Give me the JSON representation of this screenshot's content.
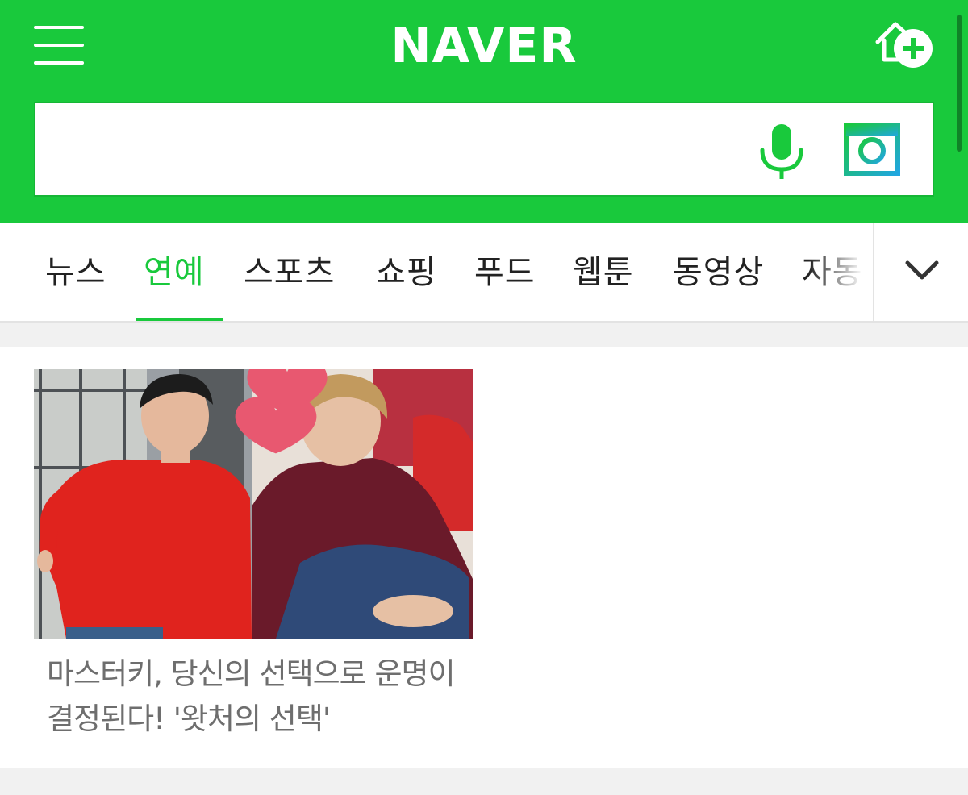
{
  "header": {
    "logo_text": "NAVER",
    "brand_color": "#19c93c",
    "menu_icon": "hamburger-menu-icon",
    "home_add_icon": "home-add-icon"
  },
  "search": {
    "value": "",
    "placeholder": "",
    "voice_icon": "microphone-icon",
    "lens_icon": "camera-lens-icon",
    "lens_color": "#21b6d0"
  },
  "tabs": {
    "items": [
      {
        "label": "뉴스"
      },
      {
        "label": "연예"
      },
      {
        "label": "스포츠"
      },
      {
        "label": "쇼핑"
      },
      {
        "label": "푸드"
      },
      {
        "label": "웹툰"
      },
      {
        "label": "동영상"
      },
      {
        "label": "자동"
      }
    ],
    "active_index": 1,
    "expand_icon": "chevron-down-icon"
  },
  "article": {
    "title": "마스터키, 당신의 선택으로 운명이 결정된다! '왓처의 선택'",
    "image_desc_icon": "article-thumbnail"
  }
}
